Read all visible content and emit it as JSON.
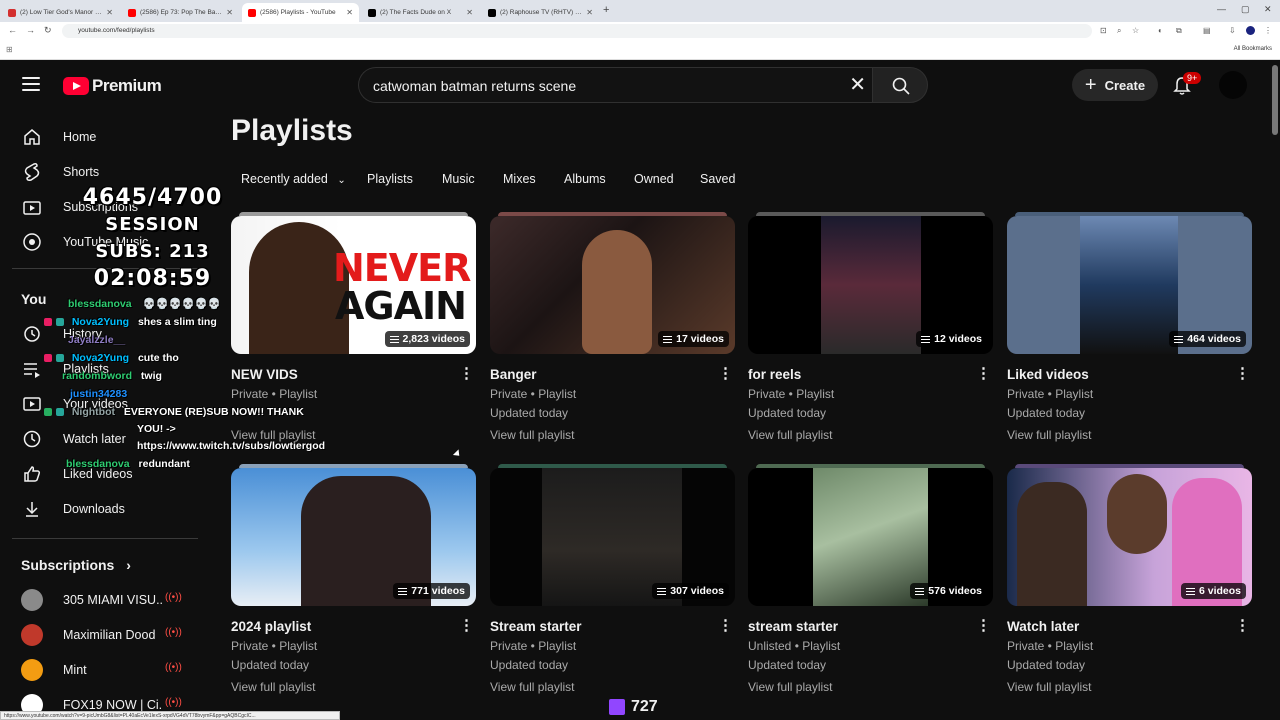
{
  "browser": {
    "tabs": [
      {
        "title": "(2) Low Tier God's Manor Com",
        "color": "#d32f2f",
        "active": false
      },
      {
        "title": "(2586) Ep 73: Pop The Balloon",
        "color": "#ff0000",
        "active": false
      },
      {
        "title": "(2586) Playlists - YouTube",
        "color": "#ff0000",
        "active": true
      },
      {
        "title": "(2) The Facts Dude on X",
        "color": "#000000",
        "active": false
      },
      {
        "title": "(2) Raphouse TV (RHTV) on X",
        "color": "#000000",
        "active": false
      }
    ],
    "url": "youtube.com/feed/playlists",
    "all_bookmarks": "All Bookmarks"
  },
  "header": {
    "logo_text": "Premium",
    "search_value": "catwoman batman returns scene",
    "create_label": "Create",
    "notification_badge": "9+"
  },
  "sidebar": {
    "items": [
      {
        "label": "Home",
        "icon": "home-icon"
      },
      {
        "label": "Shorts",
        "icon": "shorts-icon"
      },
      {
        "label": "Subscriptions",
        "icon": "subscriptions-icon"
      },
      {
        "label": "YouTube Music",
        "icon": "music-icon"
      },
      {
        "label": "You",
        "icon": ""
      },
      {
        "label": "History",
        "icon": "history-icon"
      },
      {
        "label": "Playlists",
        "icon": "playlists-icon"
      },
      {
        "label": "Your videos",
        "icon": "your-videos-icon"
      },
      {
        "label": "Watch later",
        "icon": "watch-later-icon"
      },
      {
        "label": "Liked videos",
        "icon": "liked-icon"
      },
      {
        "label": "Downloads",
        "icon": "download-icon"
      }
    ],
    "subscriptions_title": "Subscriptions",
    "subscriptions": [
      {
        "name": "305 MIAMI VISU...",
        "color": "#8a8a8a"
      },
      {
        "name": "Maximilian Dood",
        "color": "#c0392b"
      },
      {
        "name": "Mint",
        "color": "#f39c12"
      },
      {
        "name": "FOX19 NOW | Ci...",
        "color": "#ffffff"
      }
    ]
  },
  "main": {
    "title": "Playlists",
    "chips": [
      "Recently added",
      "Playlists",
      "Music",
      "Mixes",
      "Albums",
      "Owned",
      "Saved"
    ],
    "playlists": [
      {
        "title": "NEW VIDS",
        "meta1": "Private • Playlist",
        "meta2": "",
        "link": "View full playlist",
        "count": "2,823 videos",
        "thumb_text1": "NEVER",
        "thumb_text2": "AGAIN"
      },
      {
        "title": "Banger",
        "meta1": "Private • Playlist",
        "meta2": "Updated today",
        "link": "View full playlist",
        "count": "17 videos"
      },
      {
        "title": "for reels",
        "meta1": "Private • Playlist",
        "meta2": "Updated today",
        "link": "View full playlist",
        "count": "12 videos"
      },
      {
        "title": "Liked videos",
        "meta1": "Private • Playlist",
        "meta2": "Updated today",
        "link": "View full playlist",
        "count": "464 videos"
      },
      {
        "title": "2024 playlist",
        "meta1": "Private • Playlist",
        "meta2": "Updated today",
        "link": "View full playlist",
        "count": "771 videos"
      },
      {
        "title": "Stream starter",
        "meta1": "Private • Playlist",
        "meta2": "Updated today",
        "link": "View full playlist",
        "count": "307 videos"
      },
      {
        "title": "stream starter",
        "meta1": "Unlisted • Playlist",
        "meta2": "Updated today",
        "link": "View full playlist",
        "count": "576 videos"
      },
      {
        "title": "Watch later",
        "meta1": "Private • Playlist",
        "meta2": "Updated today",
        "link": "View full playlist",
        "count": "6 videos"
      }
    ]
  },
  "overlay": {
    "goal": "4645/4700",
    "session_subs": "SESSION SUBS: 213",
    "timer": "02:08:59",
    "chat": [
      {
        "user": "blessdanova",
        "msg": "💀💀💀💀💀💀",
        "color": "#2ecc71"
      },
      {
        "user": "Nova2Yung",
        "msg": "shes a slim ting",
        "color": "#00bfff"
      },
      {
        "user": "Jayalzzle__",
        "msg": "",
        "color": "#8e7cc3"
      },
      {
        "user": "Nova2Yung",
        "msg": "cute tho",
        "color": "#00bfff"
      },
      {
        "user": "randombword",
        "msg": "twig",
        "color": "#2ecc71"
      },
      {
        "user": "justin34283",
        "msg": "",
        "color": "#1e90ff"
      },
      {
        "user": "Nightbot",
        "msg": "EVERYONE (RE)SUB NOW!! THANK",
        "color": "#7f8c8d"
      },
      {
        "user": "",
        "msg": "YOU! ->",
        "color": "#ffffff"
      },
      {
        "user": "",
        "msg": "https://www.twitch.tv/subs/lowtiergod",
        "color": "#ffffff"
      },
      {
        "user": "blessdanova",
        "msg": "redundant",
        "color": "#2ecc71"
      }
    ],
    "viewer_count": "727"
  },
  "status_url": "https://www.youtube.com/watch?v=9-picUmbG8&list=PL40aEcVe1lexS-xrpdVG4dVT78bvymF&pp=gAQBCgcIC..."
}
